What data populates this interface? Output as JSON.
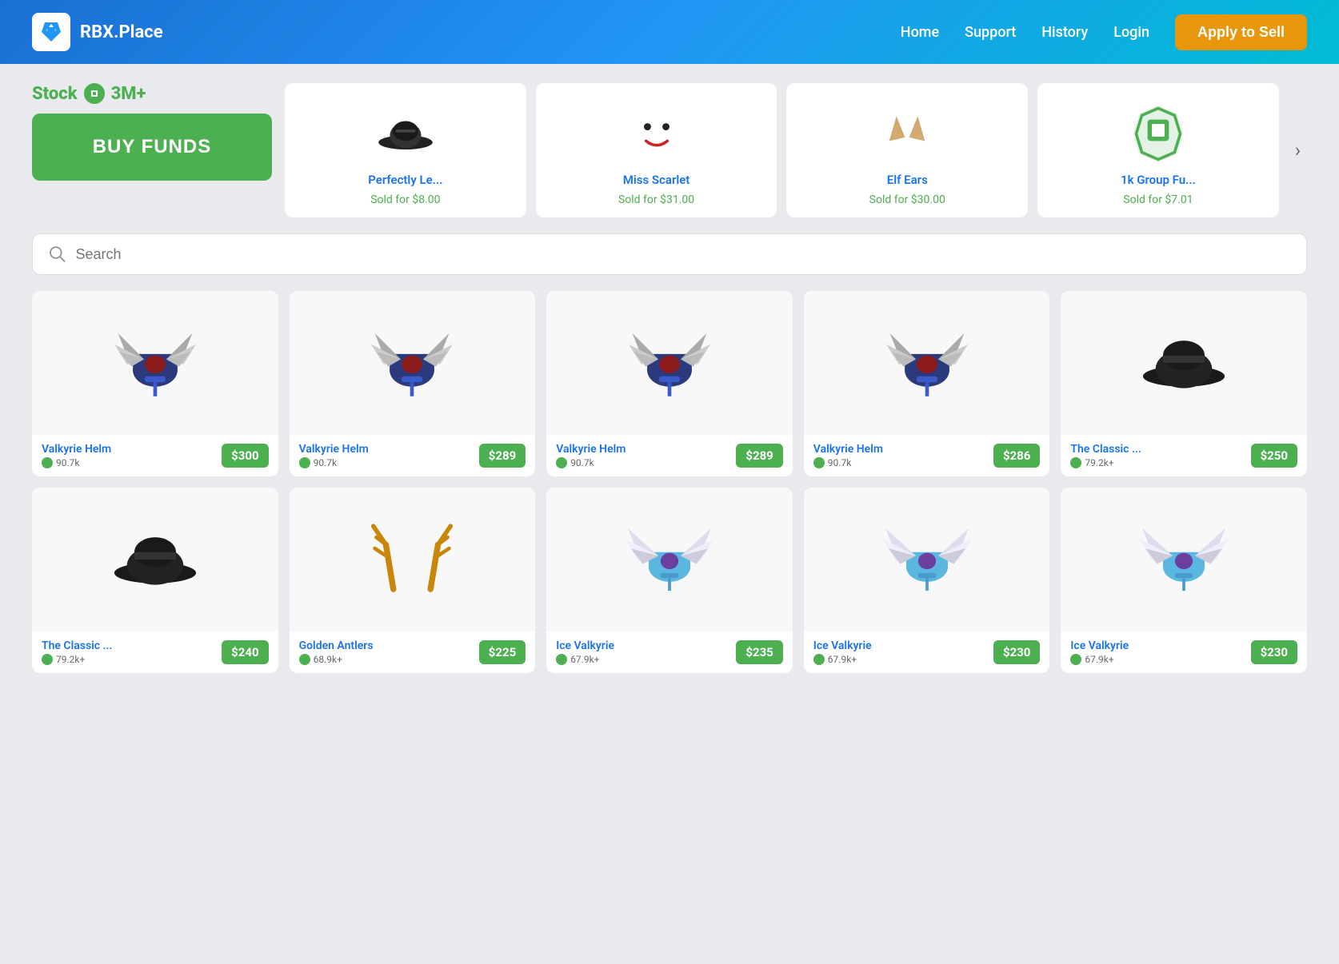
{
  "header": {
    "logo_text": "RBX.Place",
    "nav": {
      "home": "Home",
      "support": "Support",
      "history": "History",
      "login": "Login",
      "apply": "Apply to Sell"
    }
  },
  "top": {
    "stock_label": "Stock",
    "stock_amount": "3M+",
    "buy_funds_label": "BUY FUNDS"
  },
  "sold_items": [
    {
      "name": "Perfectly Le...",
      "price": "Sold for $8.00"
    },
    {
      "name": "Miss Scarlet",
      "price": "Sold for $31.00"
    },
    {
      "name": "Elf Ears",
      "price": "Sold for $30.00"
    },
    {
      "name": "1k Group Fu...",
      "price": "Sold for $7.01"
    }
  ],
  "search": {
    "placeholder": "Search"
  },
  "items": [
    {
      "name": "Valkyrie Helm",
      "demand": "90.7k",
      "price": "$300",
      "type": "valkyrie-dark"
    },
    {
      "name": "Valkyrie Helm",
      "demand": "90.7k",
      "price": "$289",
      "type": "valkyrie-dark"
    },
    {
      "name": "Valkyrie Helm",
      "demand": "90.7k",
      "price": "$289",
      "type": "valkyrie-dark"
    },
    {
      "name": "Valkyrie Helm",
      "demand": "90.7k",
      "price": "$286",
      "type": "valkyrie-dark"
    },
    {
      "name": "The Classic ...",
      "demand": "79.2k+",
      "price": "$250",
      "type": "fedora"
    },
    {
      "name": "The Classic ...",
      "demand": "79.2k+",
      "price": "$240",
      "type": "fedora"
    },
    {
      "name": "Golden Antlers",
      "demand": "68.9k+",
      "price": "$225",
      "type": "antlers"
    },
    {
      "name": "Ice Valkyrie",
      "demand": "67.9k+",
      "price": "$235",
      "type": "ice-valkyrie"
    },
    {
      "name": "Ice Valkyrie",
      "demand": "67.9k+",
      "price": "$230",
      "type": "ice-valkyrie"
    },
    {
      "name": "Ice Valkyrie",
      "demand": "67.9k+",
      "price": "$230",
      "type": "ice-valkyrie"
    }
  ]
}
